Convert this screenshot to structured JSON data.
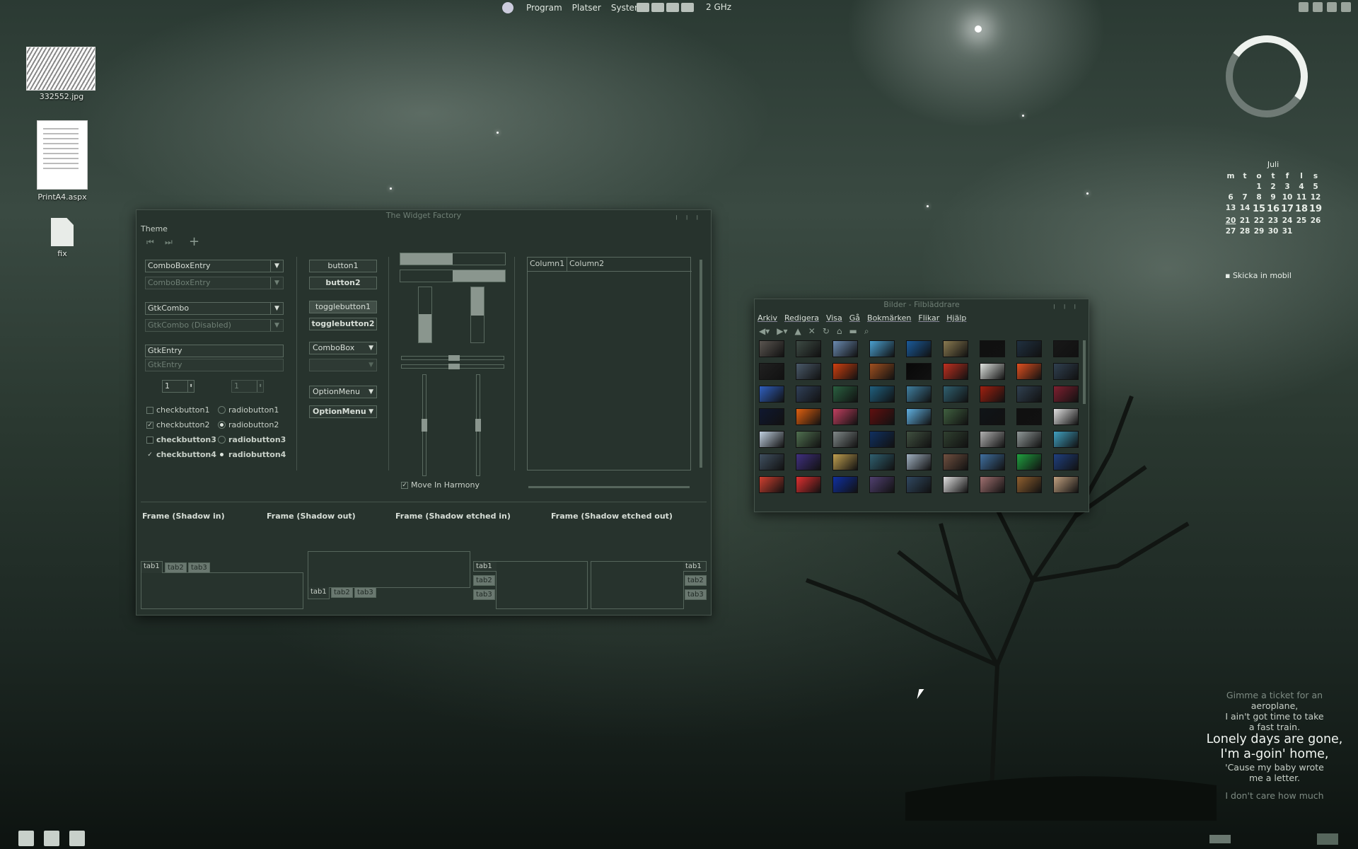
{
  "top_panel": {
    "menus": [
      "Program",
      "Platser",
      "System"
    ],
    "cpu": "2 GHz"
  },
  "desktop_icons": [
    {
      "label": "332552.jpg"
    },
    {
      "label": "PrintA4.aspx"
    },
    {
      "label": "fix"
    }
  ],
  "widget_factory": {
    "title": "The Widget Factory",
    "menu": "Theme",
    "combo_entry": "ComboBoxEntry",
    "combo_entry_disabled": "ComboBoxEntry",
    "gtk_combo": "GtkCombo",
    "gtk_combo_disabled": "GtkCombo (Disabled)",
    "gtk_entry": "GtkEntry",
    "gtk_entry_disabled": "GtkEntry",
    "spin1": "1",
    "spin2": "1",
    "checkbuttons": [
      "checkbutton1",
      "checkbutton2",
      "checkbutton3",
      "checkbutton4"
    ],
    "radiobuttons": [
      "radiobutton1",
      "radiobutton2",
      "radiobutton3",
      "radiobutton4"
    ],
    "button1": "button1",
    "button2": "button2",
    "togglebutton1": "togglebutton1",
    "togglebutton2": "togglebutton2",
    "combobox": "ComboBox",
    "optionmenu1": "OptionMenu",
    "optionmenu2": "OptionMenu",
    "move_in_harmony": "Move In Harmony",
    "columns": [
      "Column1",
      "Column2"
    ],
    "frames": [
      "Frame (Shadow in)",
      "Frame (Shadow out)",
      "Frame (Shadow etched in)",
      "Frame (Shadow etched out)"
    ],
    "tabs": [
      "tab1",
      "tab2",
      "tab3"
    ],
    "progress": {
      "bar1": 0.5,
      "bar2": 0.5
    }
  },
  "file_browser": {
    "title": "Bilder - Filbläddrare",
    "menu": [
      "Arkiv",
      "Redigera",
      "Visa",
      "Gå",
      "Bokmärken",
      "Flikar",
      "Hjälp"
    ],
    "thumb_colors": [
      "#5a5550",
      "#3d4a44",
      "#6a8ab0",
      "#4aa0d0",
      "#1a5a9a",
      "#8a7a50",
      "#101010",
      "#203040",
      "#181818",
      "#202020",
      "#4a5a6a",
      "#d04010",
      "#a05020",
      "#080808",
      "#c03020",
      "#e0e4e0",
      "#e05020",
      "#304050",
      "#3060c0",
      "#304058",
      "#2a6040",
      "#206080",
      "#4080a0",
      "#306070",
      "#a02010",
      "#304050",
      "#802030",
      "#101830",
      "#e06010",
      "#c04060",
      "#601010",
      "#60b0e0",
      "#406040",
      "#101418",
      "#101010",
      "#e0e0e0",
      "#c0d0e0",
      "#507050",
      "#808888",
      "#103060",
      "#405040",
      "#304030",
      "#b0b0b0",
      "#909898",
      "#40a0c0",
      "#405060",
      "#403080",
      "#c0a050",
      "#306070",
      "#a0b0c0",
      "#705040",
      "#4070a0",
      "#20a040",
      "#204080",
      "#d04030",
      "#e03030",
      "#1030a0",
      "#504070",
      "#304860",
      "#e0e0e0",
      "#a07070",
      "#906030",
      "#c0a080"
    ]
  },
  "calendar": {
    "month": "Juli",
    "weekdays": [
      "m",
      "t",
      "o",
      "t",
      "f",
      "l",
      "s"
    ],
    "weeks": [
      [
        "",
        "",
        "1",
        "2",
        "3",
        "4",
        "5"
      ],
      [
        "6",
        "7",
        "8",
        "9",
        "10",
        "11",
        "12"
      ],
      [
        "13",
        "14",
        "15",
        "16",
        "17",
        "18",
        "19"
      ],
      [
        "20",
        "21",
        "22",
        "23",
        "24",
        "25",
        "26"
      ],
      [
        "27",
        "28",
        "29",
        "30",
        "31",
        "",
        ""
      ]
    ],
    "today": "20"
  },
  "widget_link": "Skicka in mobil",
  "lyrics": {
    "l1": "Gimme a ticket for an",
    "l2": "aeroplane,",
    "l3": "I ain't got time to take",
    "l4": "a fast train.",
    "l5": "Lonely days are gone,",
    "l6": "I'm a-goin' home,",
    "l7": "'Cause my baby wrote",
    "l8": "me a letter.",
    "l9": "I don't care how much"
  }
}
